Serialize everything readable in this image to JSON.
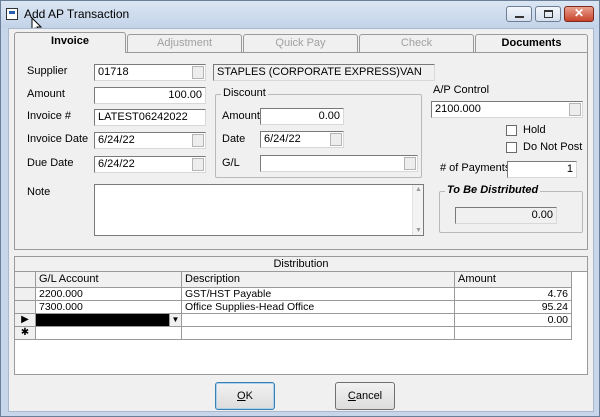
{
  "window": {
    "title": "Add AP Transaction"
  },
  "tabs": [
    "Invoice",
    "Adjustment",
    "Quick Pay",
    "Check",
    "Documents"
  ],
  "form": {
    "supplier_label": "Supplier",
    "supplier_code": "01718",
    "supplier_name": "STAPLES (CORPORATE EXPRESS)VAN",
    "amount_label": "Amount",
    "amount": "100.00",
    "invoice_label": "Invoice #",
    "invoice": "LATEST06242022",
    "invoice_date_label": "Invoice Date",
    "invoice_date": "6/24/22",
    "due_date_label": "Due Date",
    "due_date": "6/24/22",
    "note_label": "Note",
    "discount": {
      "title": "Discount",
      "amount_label": "Amount",
      "amount": "0.00",
      "date_label": "Date",
      "date": "6/24/22",
      "gl_label": "G/L",
      "gl": ""
    },
    "ap_control_label": "A/P Control",
    "ap_control": "2100.000",
    "hold_label": "Hold",
    "do_not_post_label": "Do Not Post",
    "payments_label": "# of Payments",
    "payments": "1",
    "to_be_distributed_title": "To Be Distributed",
    "to_be_distributed": "0.00"
  },
  "distribution": {
    "title": "Distribution",
    "columns": [
      "G/L Account",
      "Description",
      "Amount"
    ],
    "rows": [
      {
        "account": "2200.000",
        "description": "GST/HST Payable",
        "amount": "4.76"
      },
      {
        "account": "7300.000",
        "description": "Office Supplies-Head Office",
        "amount": "95.24"
      },
      {
        "account": "",
        "description": "",
        "amount": "0.00"
      }
    ],
    "row_markers": [
      "",
      "",
      "▶",
      "✱"
    ]
  },
  "buttons": {
    "ok_prefix": "",
    "ok_key": "O",
    "ok_rest": "K",
    "cancel_key": "C",
    "cancel_rest": "ancel"
  }
}
